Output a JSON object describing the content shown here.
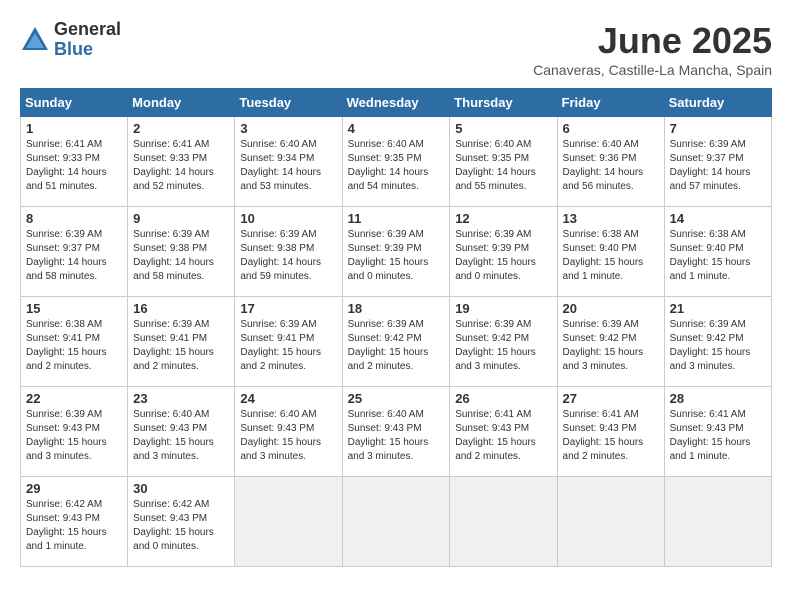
{
  "logo": {
    "general": "General",
    "blue": "Blue"
  },
  "title": "June 2025",
  "location": "Canaveras, Castille-La Mancha, Spain",
  "headers": [
    "Sunday",
    "Monday",
    "Tuesday",
    "Wednesday",
    "Thursday",
    "Friday",
    "Saturday"
  ],
  "weeks": [
    [
      {
        "day": "1",
        "info": "Sunrise: 6:41 AM\nSunset: 9:33 PM\nDaylight: 14 hours\nand 51 minutes."
      },
      {
        "day": "2",
        "info": "Sunrise: 6:41 AM\nSunset: 9:33 PM\nDaylight: 14 hours\nand 52 minutes."
      },
      {
        "day": "3",
        "info": "Sunrise: 6:40 AM\nSunset: 9:34 PM\nDaylight: 14 hours\nand 53 minutes."
      },
      {
        "day": "4",
        "info": "Sunrise: 6:40 AM\nSunset: 9:35 PM\nDaylight: 14 hours\nand 54 minutes."
      },
      {
        "day": "5",
        "info": "Sunrise: 6:40 AM\nSunset: 9:35 PM\nDaylight: 14 hours\nand 55 minutes."
      },
      {
        "day": "6",
        "info": "Sunrise: 6:40 AM\nSunset: 9:36 PM\nDaylight: 14 hours\nand 56 minutes."
      },
      {
        "day": "7",
        "info": "Sunrise: 6:39 AM\nSunset: 9:37 PM\nDaylight: 14 hours\nand 57 minutes."
      }
    ],
    [
      {
        "day": "8",
        "info": "Sunrise: 6:39 AM\nSunset: 9:37 PM\nDaylight: 14 hours\nand 58 minutes."
      },
      {
        "day": "9",
        "info": "Sunrise: 6:39 AM\nSunset: 9:38 PM\nDaylight: 14 hours\nand 58 minutes."
      },
      {
        "day": "10",
        "info": "Sunrise: 6:39 AM\nSunset: 9:38 PM\nDaylight: 14 hours\nand 59 minutes."
      },
      {
        "day": "11",
        "info": "Sunrise: 6:39 AM\nSunset: 9:39 PM\nDaylight: 15 hours\nand 0 minutes."
      },
      {
        "day": "12",
        "info": "Sunrise: 6:39 AM\nSunset: 9:39 PM\nDaylight: 15 hours\nand 0 minutes."
      },
      {
        "day": "13",
        "info": "Sunrise: 6:38 AM\nSunset: 9:40 PM\nDaylight: 15 hours\nand 1 minute."
      },
      {
        "day": "14",
        "info": "Sunrise: 6:38 AM\nSunset: 9:40 PM\nDaylight: 15 hours\nand 1 minute."
      }
    ],
    [
      {
        "day": "15",
        "info": "Sunrise: 6:38 AM\nSunset: 9:41 PM\nDaylight: 15 hours\nand 2 minutes."
      },
      {
        "day": "16",
        "info": "Sunrise: 6:39 AM\nSunset: 9:41 PM\nDaylight: 15 hours\nand 2 minutes."
      },
      {
        "day": "17",
        "info": "Sunrise: 6:39 AM\nSunset: 9:41 PM\nDaylight: 15 hours\nand 2 minutes."
      },
      {
        "day": "18",
        "info": "Sunrise: 6:39 AM\nSunset: 9:42 PM\nDaylight: 15 hours\nand 2 minutes."
      },
      {
        "day": "19",
        "info": "Sunrise: 6:39 AM\nSunset: 9:42 PM\nDaylight: 15 hours\nand 3 minutes."
      },
      {
        "day": "20",
        "info": "Sunrise: 6:39 AM\nSunset: 9:42 PM\nDaylight: 15 hours\nand 3 minutes."
      },
      {
        "day": "21",
        "info": "Sunrise: 6:39 AM\nSunset: 9:42 PM\nDaylight: 15 hours\nand 3 minutes."
      }
    ],
    [
      {
        "day": "22",
        "info": "Sunrise: 6:39 AM\nSunset: 9:43 PM\nDaylight: 15 hours\nand 3 minutes."
      },
      {
        "day": "23",
        "info": "Sunrise: 6:40 AM\nSunset: 9:43 PM\nDaylight: 15 hours\nand 3 minutes."
      },
      {
        "day": "24",
        "info": "Sunrise: 6:40 AM\nSunset: 9:43 PM\nDaylight: 15 hours\nand 3 minutes."
      },
      {
        "day": "25",
        "info": "Sunrise: 6:40 AM\nSunset: 9:43 PM\nDaylight: 15 hours\nand 3 minutes."
      },
      {
        "day": "26",
        "info": "Sunrise: 6:41 AM\nSunset: 9:43 PM\nDaylight: 15 hours\nand 2 minutes."
      },
      {
        "day": "27",
        "info": "Sunrise: 6:41 AM\nSunset: 9:43 PM\nDaylight: 15 hours\nand 2 minutes."
      },
      {
        "day": "28",
        "info": "Sunrise: 6:41 AM\nSunset: 9:43 PM\nDaylight: 15 hours\nand 1 minute."
      }
    ],
    [
      {
        "day": "29",
        "info": "Sunrise: 6:42 AM\nSunset: 9:43 PM\nDaylight: 15 hours\nand 1 minute."
      },
      {
        "day": "30",
        "info": "Sunrise: 6:42 AM\nSunset: 9:43 PM\nDaylight: 15 hours\nand 0 minutes."
      },
      null,
      null,
      null,
      null,
      null
    ]
  ]
}
